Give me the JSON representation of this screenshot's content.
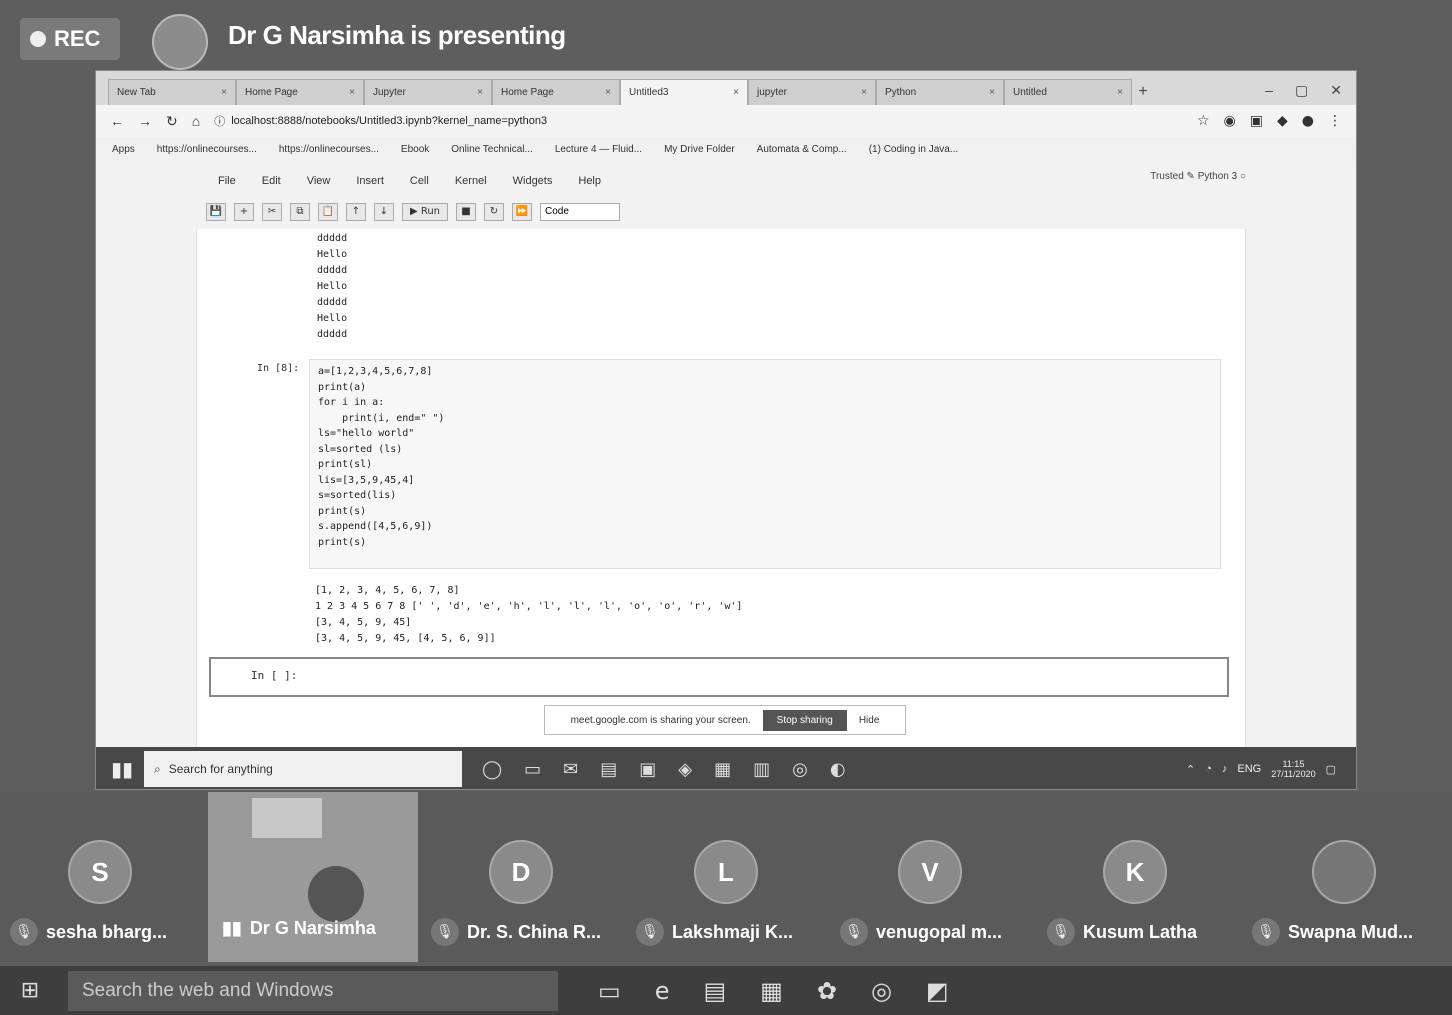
{
  "share_bar": {
    "rec_label": "REC",
    "presenting_text": "Dr G Narsimha is presenting"
  },
  "browser": {
    "tabs": [
      {
        "label": "New Tab"
      },
      {
        "label": "Home Page"
      },
      {
        "label": "Jupyter"
      },
      {
        "label": "Home Page"
      },
      {
        "label": "Untitled3"
      },
      {
        "label": "jupyter"
      },
      {
        "label": "Python"
      },
      {
        "label": "Untitled"
      }
    ],
    "url": "localhost:8888/notebooks/Untitled3.ipynb?kernel_name=python3",
    "bookmarks": [
      "Apps",
      "https://onlinecourses...",
      "https://onlinecourses...",
      "Ebook",
      "Online Technical...",
      "Lecture 4 — Fluid...",
      "My Drive Folder",
      "Automata & Comp...",
      "(1) Coding in Java..."
    ]
  },
  "jupyter": {
    "menu": [
      "File",
      "Edit",
      "View",
      "Insert",
      "Cell",
      "Kernel",
      "Widgets",
      "Help"
    ],
    "kernel_info": "Trusted  ✎  Python 3 ○",
    "toolbar_icons": [
      "💾",
      "+",
      "✂",
      "⧉",
      "📋",
      "↑",
      "↓",
      "▶ Run",
      "■",
      "↻",
      "⏩"
    ],
    "cell_type": "Code",
    "output_lines": [
      "ddddd",
      "Hello",
      "ddddd",
      "Hello",
      "ddddd",
      "Hello",
      "ddddd"
    ],
    "input_prompt": "In [8]:",
    "code_lines": [
      "a=[1,2,3,4,5,6,7,8]",
      "print(a)",
      "for i in a:",
      "    print(i, end=\" \")",
      "ls=\"hello world\"",
      "sl=sorted (ls)",
      "print(sl)",
      "lis=[3,5,9,45,4]",
      "s=sorted(lis)",
      "print(s)",
      "s.append([4,5,6,9])",
      "print(s)"
    ],
    "cell_output_lines": [
      "[1, 2, 3, 4, 5, 6, 7, 8]",
      "1 2 3 4 5 6 7 8 [' ', 'd', 'e', 'h', 'l', 'l', 'l', 'o', 'o', 'r', 'w']",
      "[3, 4, 5, 9, 45]",
      "[3, 4, 5, 9, 45, [4, 5, 6, 9]]"
    ],
    "new_cell_prompt": "In [ ]:"
  },
  "share_notice": {
    "text": "meet.google.com is sharing your screen.",
    "stop_label": "Stop sharing",
    "hide_label": "Hide"
  },
  "inner_taskbar": {
    "search_placeholder": "Search for anything",
    "tray_text": "ENG",
    "time": "11:15",
    "date": "27/11/2020"
  },
  "participants": [
    {
      "initial": "S",
      "name": "sesha bharg..."
    },
    {
      "initial": "",
      "name": "Dr G Narsimha"
    },
    {
      "initial": "D",
      "name": "Dr. S. China R..."
    },
    {
      "initial": "L",
      "name": "Lakshmaji K..."
    },
    {
      "initial": "V",
      "name": "venugopal m..."
    },
    {
      "initial": "K",
      "name": "Kusum Latha"
    },
    {
      "initial": "",
      "name": "Swapna Mud..."
    }
  ],
  "os_taskbar": {
    "search_placeholder": "Search the web and Windows"
  },
  "colors": {
    "background": "#5e5e5e",
    "screen": "#f2f2f2",
    "taskbar": "#3e3e3e"
  }
}
